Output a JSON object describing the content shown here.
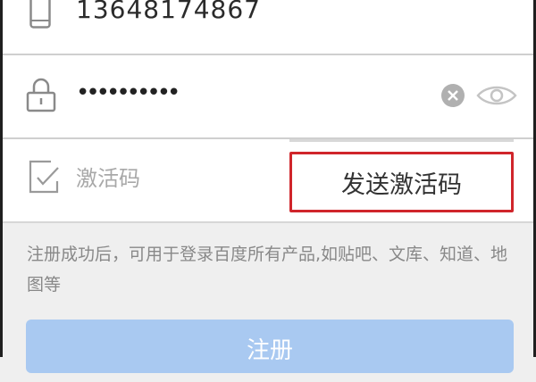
{
  "form": {
    "phone": {
      "value": "13648174867",
      "icon": "phone-icon"
    },
    "password": {
      "value": "••••••••••",
      "icons": [
        "lock-icon",
        "clear-icon",
        "eye-icon"
      ]
    },
    "activation": {
      "placeholder": "激活码",
      "icon": "check-document-icon"
    },
    "send_code_label": "发送激活码"
  },
  "notice": "注册成功后，可用于登录百度所有产品,如贴吧、文库、知道、地图等",
  "register_label": "注册",
  "colors": {
    "background": "#efefef",
    "highlight_border": "#d0252b",
    "register_button": "#a9c9f1",
    "notice_text": "#888888"
  }
}
